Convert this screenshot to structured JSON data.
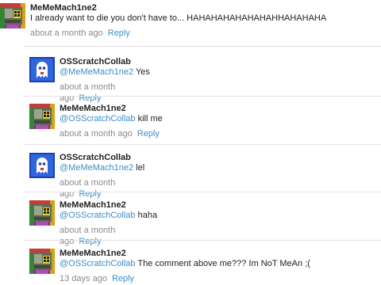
{
  "comments": [
    {
      "username": "MeMeMach1ne2",
      "mention": "",
      "text": "I already want to die you don't have to... HAHAHAHAHAHAHAHHAHAHAHA",
      "time": "about a month ago",
      "reply_label": "Reply",
      "avatar": "pixel-computer-avatar"
    },
    {
      "username": "OSScratchCollab",
      "mention": "@MeMeMach1ne2",
      "text": " Yes",
      "time": "about a month ago",
      "reply_label": "Reply",
      "avatar": "blue-ghost-avatar"
    },
    {
      "username": "MeMeMach1ne2",
      "mention": "@OSScratchCollab",
      "text": " kill me",
      "time": "about a month ago",
      "reply_label": "Reply",
      "avatar": "pixel-computer-avatar"
    },
    {
      "username": "OSScratchCollab",
      "mention": "@MeMeMach1ne2",
      "text": " lel",
      "time": "about a month ago",
      "reply_label": "Reply",
      "avatar": "blue-ghost-avatar"
    },
    {
      "username": "MeMeMach1ne2",
      "mention": "@OSScratchCollab",
      "text": " haha",
      "time": "about a month ago",
      "reply_label": "Reply",
      "avatar": "pixel-computer-avatar"
    },
    {
      "username": "MeMeMach1ne2",
      "mention": "@OSScratchCollab",
      "text": " The comment above me??? Im NoT MeAn ;(",
      "time": "13 days ago",
      "reply_label": "Reply",
      "avatar": "pixel-computer-avatar"
    }
  ],
  "colors": {
    "link": "#3a8ec9",
    "meta": "#8a8a8a",
    "divider": "#e2e2e2"
  }
}
